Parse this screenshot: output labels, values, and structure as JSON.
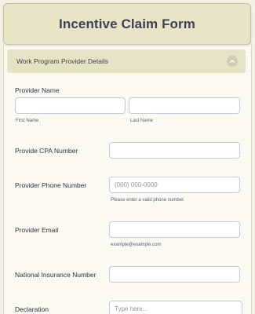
{
  "form": {
    "title": "Incentive Claim Form"
  },
  "section": {
    "title": "Work Program Provider Details",
    "collapse_icon": "chevron-up-icon"
  },
  "fields": {
    "provider_name": {
      "label": "Provider Name",
      "first": {
        "value": "",
        "placeholder": "",
        "sublabel": "First Name"
      },
      "last": {
        "value": "",
        "placeholder": "",
        "sublabel": "Last Name"
      }
    },
    "cpa_number": {
      "label": "Provide CPA Number",
      "value": "",
      "placeholder": ""
    },
    "phone": {
      "label": "Provider Phone Number",
      "value": "",
      "placeholder": "(000) 000-0000",
      "sublabel": "Please enter a valid phone number."
    },
    "email": {
      "label": "Provider Email",
      "value": "",
      "placeholder": "",
      "sublabel": "example@example.com"
    },
    "ni_number": {
      "label": "National Insurance Number",
      "value": "",
      "placeholder": ""
    },
    "declaration": {
      "label": "Declaration",
      "value": "",
      "placeholder": "Type here..."
    }
  },
  "colors": {
    "background": "#f4f1e4",
    "header": "#e8e4c6",
    "section_bar": "#e6e2c4",
    "input_border": "#c3cad8",
    "text": "#2c3345"
  }
}
